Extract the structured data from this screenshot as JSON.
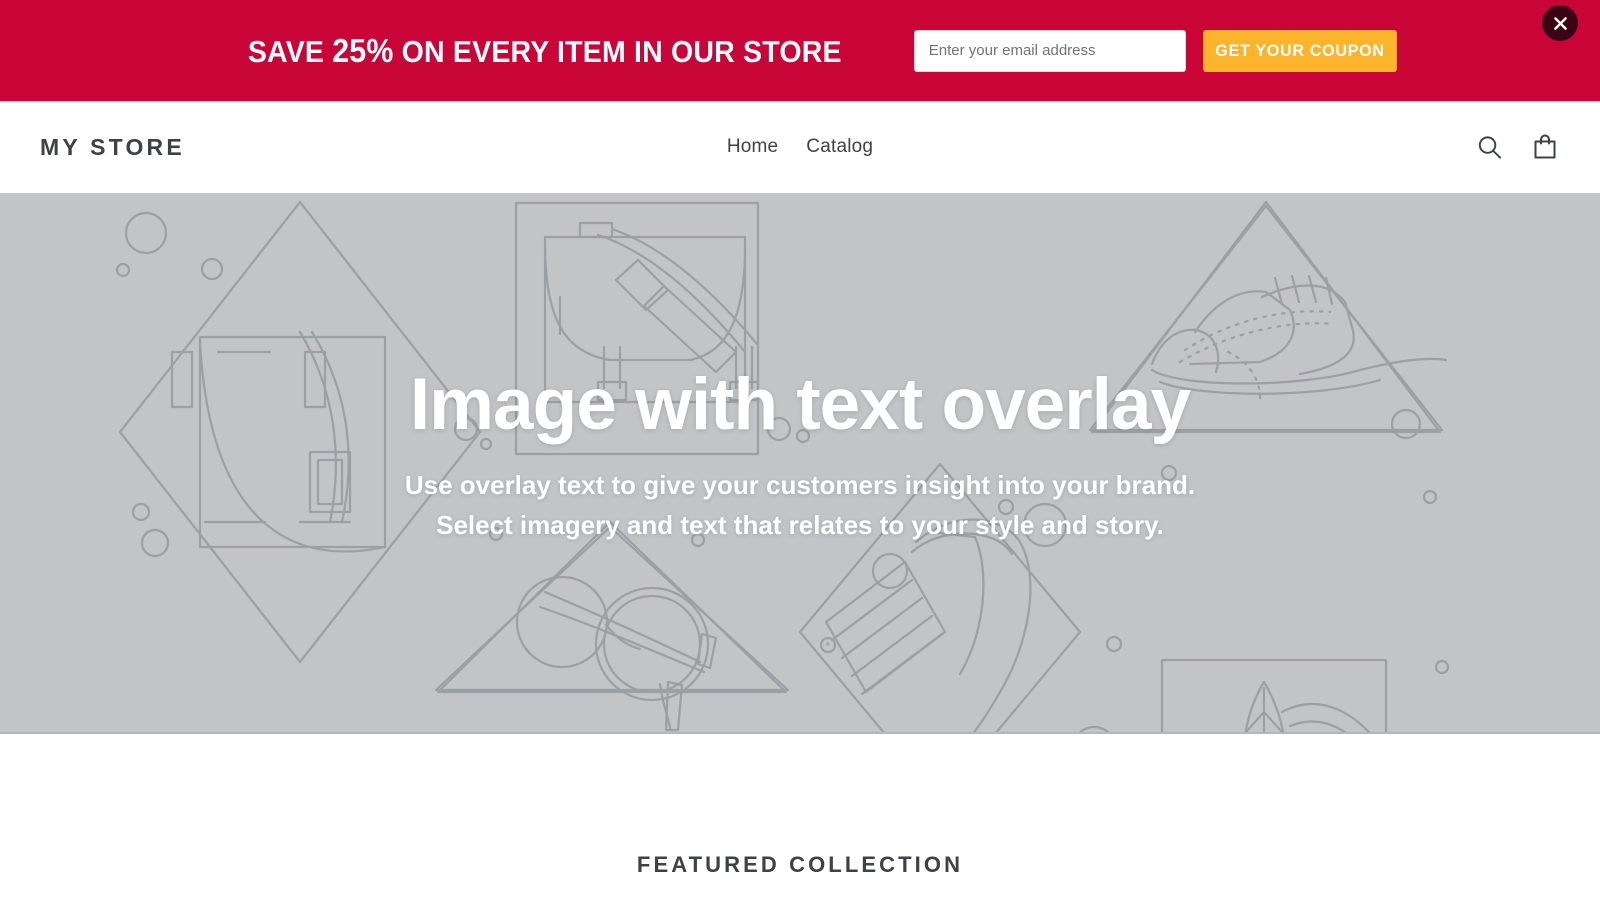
{
  "promo": {
    "text_prefix": "SAVE ",
    "text_accent": "25%",
    "text_suffix": " ON EVERY ITEM IN OUR STORE",
    "email_placeholder": "Enter your email address",
    "email_value": "",
    "submit_label": "GET YOUR COUPON",
    "close_icon": "close-icon",
    "background_color": "#c90538",
    "button_color": "#fbb42c"
  },
  "header": {
    "brand": "MY STORE",
    "nav": [
      {
        "label": "Home"
      },
      {
        "label": "Catalog"
      }
    ],
    "search_icon": "search-icon",
    "cart_icon": "cart-icon",
    "text_color": "#3d4246"
  },
  "hero": {
    "title": "Image with text overlay",
    "subtitle_line1": "Use overlay text to give your customers insight into your brand.",
    "subtitle_line2": "Select imagery and text that relates to your style and story.",
    "background_color": "#c2c4c6",
    "illustration": "product-placeholder-line-art"
  },
  "featured": {
    "title": "FEATURED COLLECTION"
  }
}
